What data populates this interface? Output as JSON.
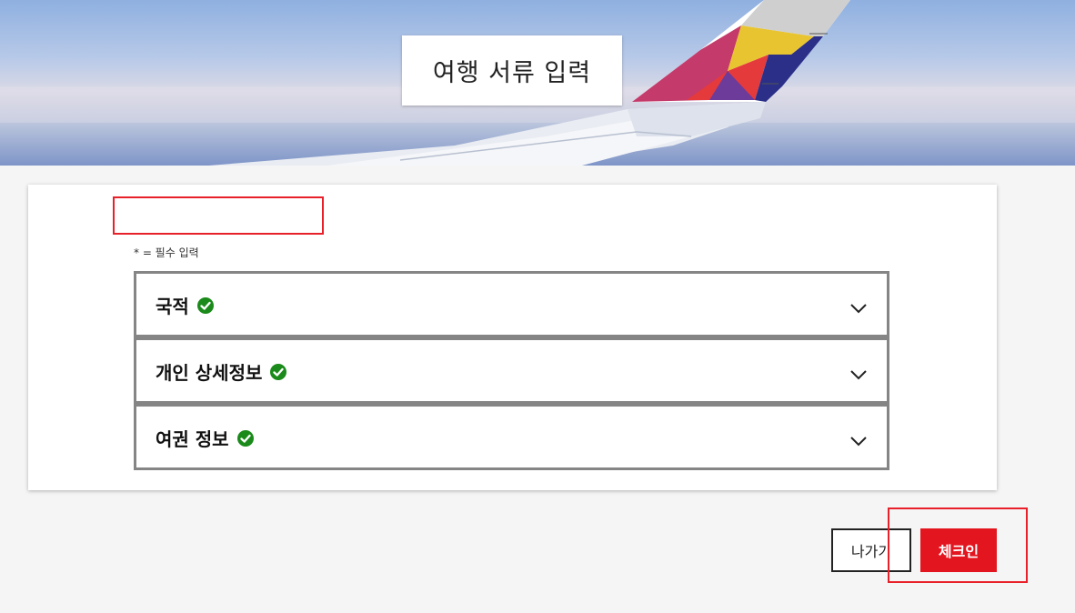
{
  "header": {
    "title": "여행 서류 입력"
  },
  "form": {
    "required_note": "* = 필수 입력",
    "sections": [
      {
        "label": "국적",
        "completed": true
      },
      {
        "label": "개인 상세정보",
        "completed": true
      },
      {
        "label": "여권 정보",
        "completed": true
      }
    ]
  },
  "actions": {
    "exit_label": "나가기",
    "checkin_label": "체크인"
  },
  "colors": {
    "accent": "#e3161f",
    "check": "#1a8a1a",
    "highlight": "#e8202a"
  }
}
